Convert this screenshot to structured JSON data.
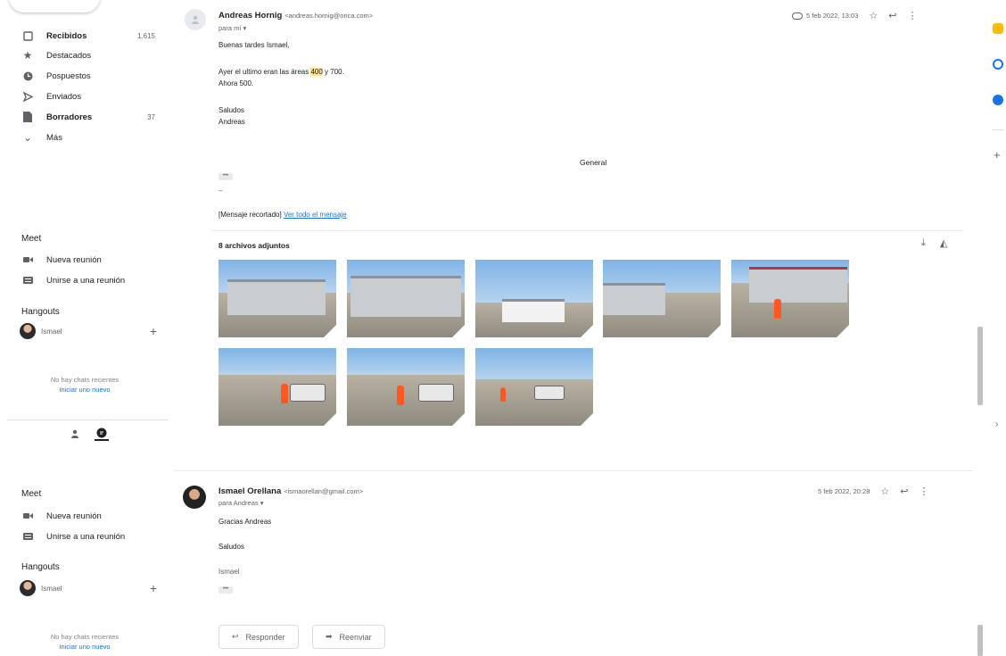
{
  "nav": {
    "items": [
      {
        "label": "Recibidos",
        "count": "1.615",
        "bold": true,
        "icon": "inbox-icon"
      },
      {
        "label": "Destacados",
        "count": "",
        "bold": false,
        "icon": "star-icon"
      },
      {
        "label": "Pospuestos",
        "count": "",
        "bold": false,
        "icon": "clock-icon"
      },
      {
        "label": "Enviados",
        "count": "",
        "bold": false,
        "icon": "send-icon"
      },
      {
        "label": "Borradores",
        "count": "37",
        "bold": true,
        "icon": "draft-icon"
      },
      {
        "label": "Más",
        "count": "",
        "bold": false,
        "icon": "chevron-down-icon"
      }
    ]
  },
  "sidebar_top": {
    "meet_title": "Meet",
    "new_meeting": "Nueva reunión",
    "join_meeting": "Unirse a una reunión",
    "hangouts_title": "Hangouts",
    "user": "Ismael",
    "no_chats": "No hay chats recientes",
    "start_new": "Iniciar uno nuevo"
  },
  "sidebar_bottom": {
    "meet_title": "Meet",
    "new_meeting": "Nueva reunión",
    "join_meeting": "Unirse a una reunión",
    "hangouts_title": "Hangouts",
    "user": "Ismael",
    "no_chats": "No hay chats recientes",
    "start_new": "Iniciar uno nuevo"
  },
  "message1": {
    "sender_name": "Andreas Hornig",
    "sender_email": "<andreas.hornig@orica.com>",
    "to": "para mí",
    "date": "5 feb 2022, 13:03",
    "greeting": "Buenas tardes Ismael,",
    "line1_before": "Ayer el ultimo eran las áreas ",
    "line1_highlight": "400",
    "line1_after": " y 700.",
    "line2": "Ahora 500.",
    "sign1": "Saludos",
    "sign2": "Andreas",
    "general": "General",
    "dash": "–",
    "clipped_prefix": "[Mensaje recortado]",
    "clipped_link": "Ver todo el mensaje",
    "attachments_title": "8 archivos adjuntos"
  },
  "message2": {
    "sender_name": "Ismael Orellana",
    "sender_email": "<ismaorellan@gmail.com>",
    "to": "para Andreas",
    "date": "5 feb 2022, 20:28",
    "line1": "Gracias Andreas",
    "sign1": "Saludos",
    "sign2": "Ismael"
  },
  "actions": {
    "reply": "Responder",
    "forward": "Reenviar"
  }
}
